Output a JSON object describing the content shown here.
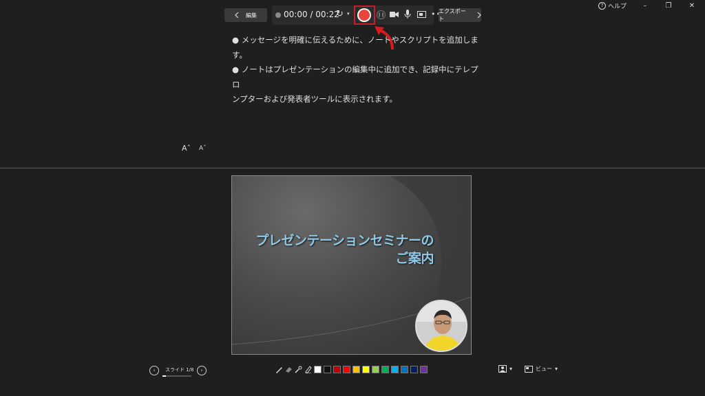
{
  "window": {
    "help_label": "ヘルプ",
    "help_icon_glyph": "?",
    "minimize_glyph": "–",
    "restore_glyph": "❐",
    "close_glyph": "✕"
  },
  "toolbar": {
    "edit_label": "編集",
    "export_label": "エクスポート",
    "timer": "00:00 / 00:22",
    "reset_glyph": "↻",
    "dropdown_glyph": "▾",
    "pause_glyph": "❚❚",
    "more_glyph": "•••",
    "record_color": "#e8453c",
    "highlight_color": "#c7202c"
  },
  "notes": {
    "lines": [
      "● メッセージを明確に伝えるために、ノートやスクリプトを追加します。",
      "● ノートはプレゼンテーションの編集中に追加でき、記録中にテレプロ",
      "ンプターおよび発表者ツールに表示されます。"
    ]
  },
  "font_controls": {
    "increase": "Aˆ",
    "decrease": "Aˇ"
  },
  "slide": {
    "title_line1": "プレゼンテーションセミナーの",
    "title_line2": "ご案内",
    "title_color": "#8ec8e6"
  },
  "bottom": {
    "prev_glyph": "‹",
    "next_glyph": "›",
    "slide_counter": "スライド 1/8",
    "progress_fraction": 0.125,
    "pen_colors": [
      "#ffffff",
      "#111111",
      "#c00000",
      "#ff0000",
      "#ffc000",
      "#ffff00",
      "#92d050",
      "#00b050",
      "#00b0f0",
      "#0070c0",
      "#002060",
      "#7030a0"
    ],
    "view_label": "ビュー",
    "dropdown_glyph": "▾"
  }
}
